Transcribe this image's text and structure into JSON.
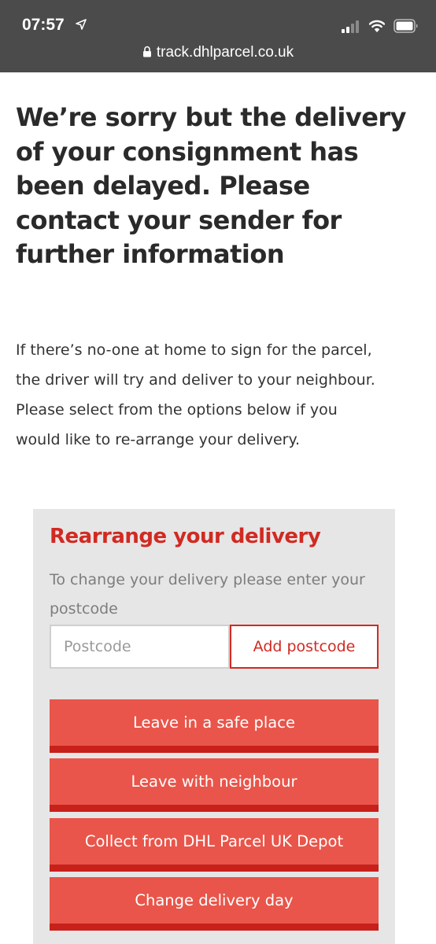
{
  "status_bar": {
    "time": "07:57",
    "icons": [
      "location-arrow-icon",
      "signal-icon",
      "wifi-icon",
      "battery-icon"
    ]
  },
  "browser": {
    "url": "track.dhlparcel.co.uk",
    "lock_icon": "lock-icon"
  },
  "main": {
    "headline": "We’re sorry but the delivery of your consignment has been delayed. Please contact your sender for further information",
    "intro": "If there’s no-one at home to sign for the parcel, the driver will try and deliver to your neighbour. Please select from the options below if you would like to re-arrange your delivery."
  },
  "rearrange": {
    "title": "Rearrange your delivery",
    "hint": "To change your delivery please enter your postcode",
    "postcode": {
      "value": "",
      "placeholder": "Postcode"
    },
    "add_postcode_label": "Add postcode",
    "options": [
      {
        "label": "Leave in a safe place"
      },
      {
        "label": "Leave with neighbour"
      },
      {
        "label": "Collect from DHL Parcel UK Depot"
      },
      {
        "label": "Change delivery day"
      }
    ]
  },
  "colors": {
    "chrome_bg": "#4b4b4b",
    "brand_red": "#d12a22",
    "button_red": "#e9554a",
    "button_shadow": "#c8201a",
    "card_bg": "#e6e6e6"
  }
}
